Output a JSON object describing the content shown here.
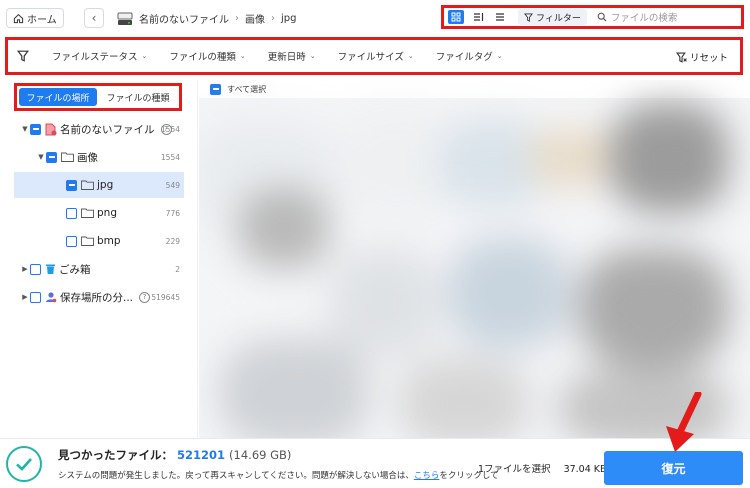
{
  "topbar": {
    "home_label": "ホーム",
    "breadcrumbs": [
      "名前のないファイル",
      "画像",
      "jpg"
    ],
    "filter_label": "フィルター",
    "search_placeholder": "ファイルの検索"
  },
  "filters": {
    "items": [
      "ファイルステータス",
      "ファイルの種類",
      "更新日時",
      "ファイルサイズ",
      "ファイルタグ"
    ],
    "reset_label": "リセット"
  },
  "sidebar": {
    "tabs": [
      "ファイルの場所",
      "ファイルの種類"
    ],
    "tree": [
      {
        "label": "名前のないファイル",
        "count": "1554"
      },
      {
        "label": "画像",
        "count": "1554"
      },
      {
        "label": "jpg",
        "count": "549"
      },
      {
        "label": "png",
        "count": "776"
      },
      {
        "label": "bmp",
        "count": "229"
      },
      {
        "label": "ごみ箱",
        "count": "2"
      },
      {
        "label": "保存場所の分...",
        "count": "519645"
      }
    ]
  },
  "main": {
    "select_all_label": "すべて選択"
  },
  "bottom": {
    "found_label": "見つかったファイル：",
    "found_count": "521201",
    "found_size": "(14.69 GB)",
    "system_message": "システムの問題が発生しました。戻って再スキャンしてください。問題が解決しない場合は、",
    "link_text": "こちら",
    "message_tail": "をクリックして",
    "selection_label": "1ファイルを選択",
    "selection_size": "37.04 KB",
    "recover_label": "復元"
  },
  "colors": {
    "accent": "#1f7bf0",
    "highlight_box": "#e41b1b",
    "recover_button": "#2d8cf7"
  }
}
